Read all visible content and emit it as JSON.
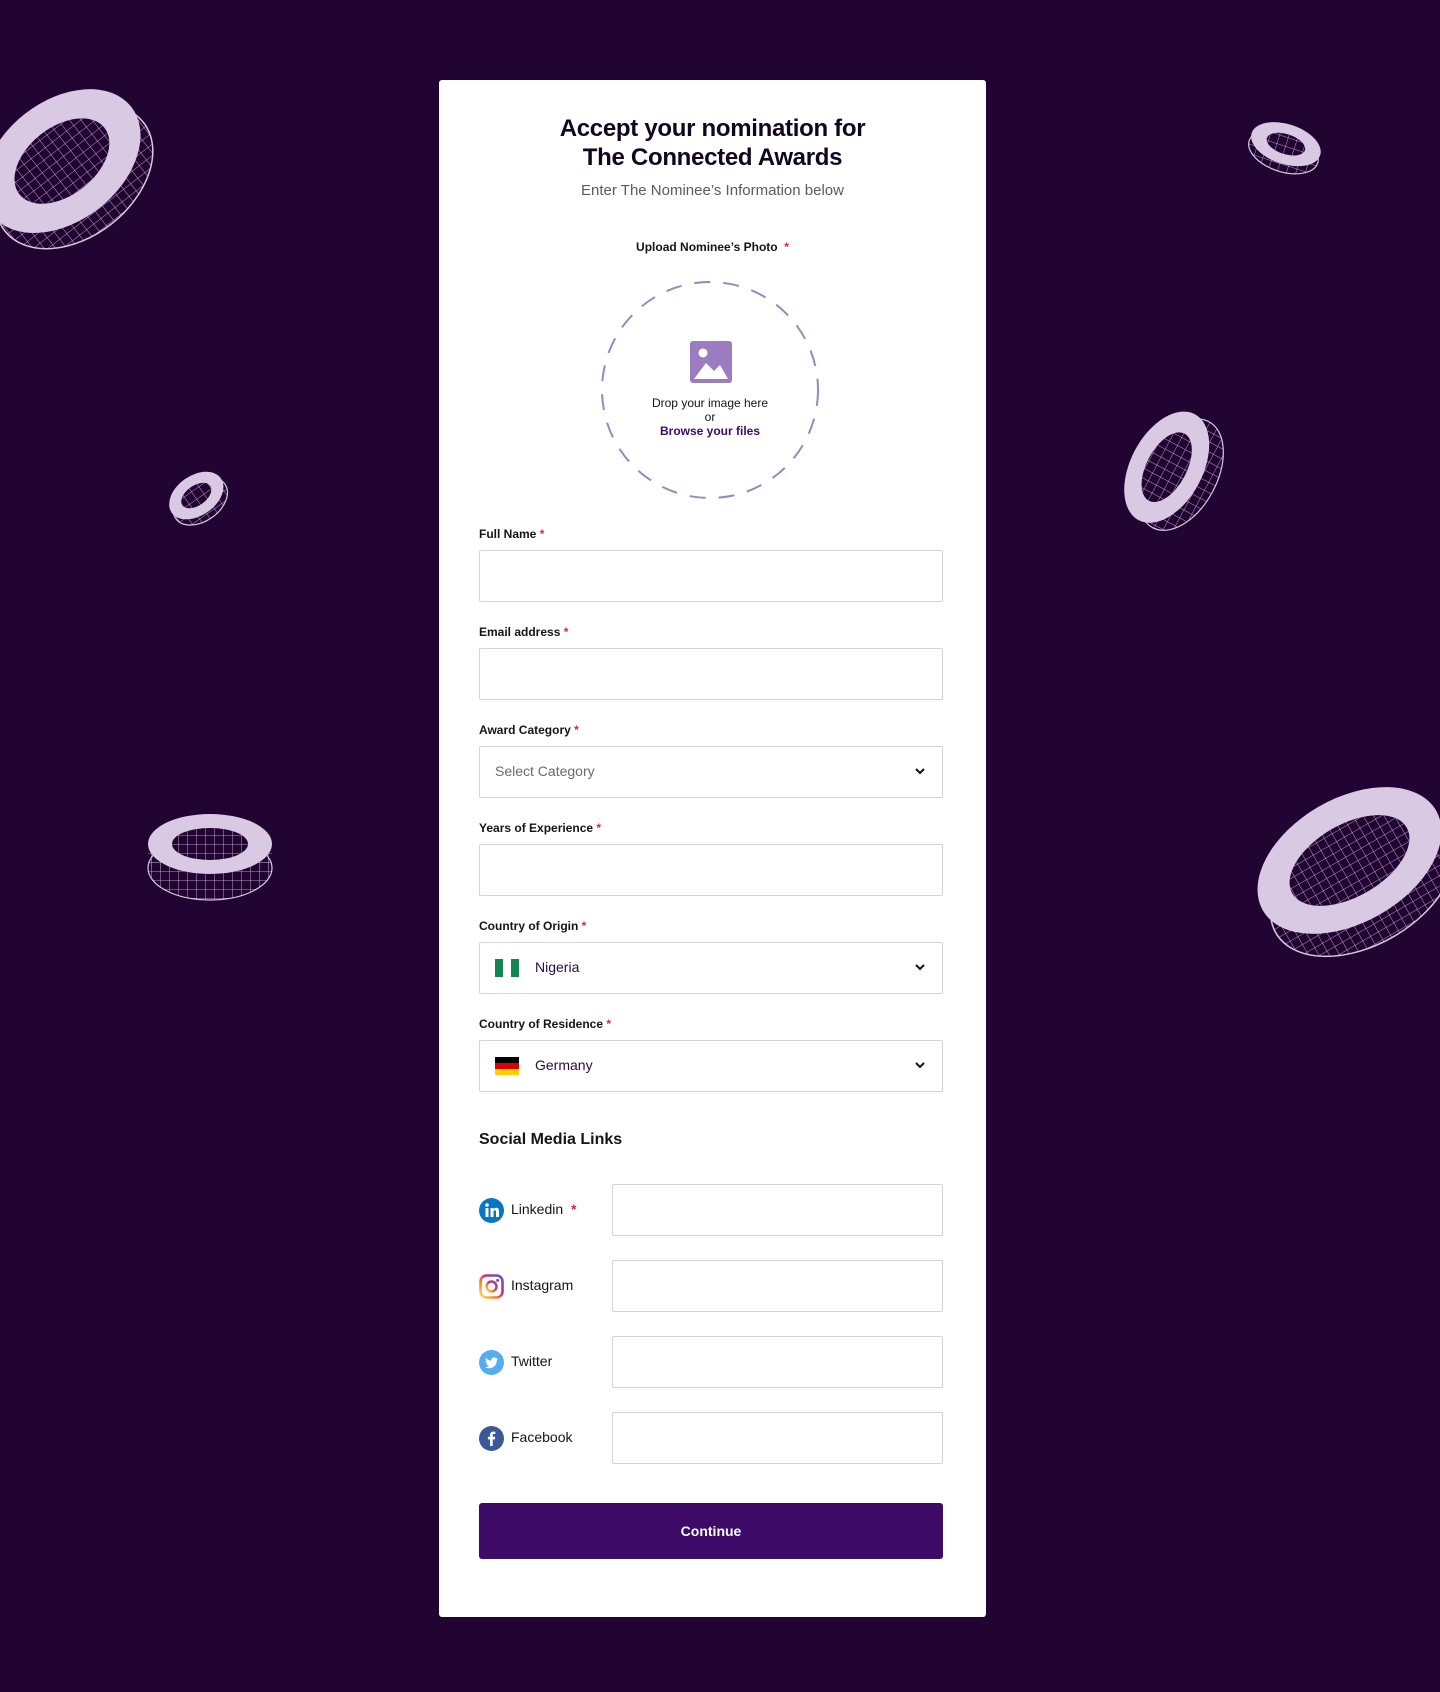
{
  "colors": {
    "background": "#220433",
    "card": "#ffffff",
    "primary": "#3d0a68",
    "required": "#e0243a",
    "ring": "#d9c9e3",
    "dashed_border": "#9b86c0"
  },
  "header": {
    "title_line1": "Accept your nomination for",
    "title_line2": "The Connected Awards",
    "subtitle": "Enter The Nominee’s Information below"
  },
  "upload": {
    "label": "Upload Nominee’s Photo",
    "required_mark": "*",
    "icon": "image-icon",
    "drop_text": "Drop your image here",
    "or_text": "or",
    "browse_text": "Browse your files"
  },
  "fields": {
    "full_name": {
      "label": "Full Name",
      "required_mark": "*",
      "value": ""
    },
    "email": {
      "label": "Email address",
      "required_mark": "*",
      "value": ""
    },
    "award_category": {
      "label": "Award Category",
      "required_mark": "*",
      "placeholder": "Select Category"
    },
    "years_experience": {
      "label": "Years of Experience",
      "required_mark": "*",
      "value": ""
    },
    "country_origin": {
      "label": "Country of Origin",
      "required_mark": "*",
      "value": "Nigeria",
      "flag": "nigeria-flag-icon"
    },
    "country_residence": {
      "label": "Country of Residence",
      "required_mark": "*",
      "value": "Germany",
      "flag": "germany-flag-icon"
    }
  },
  "social": {
    "title": "Social Media Links",
    "items": [
      {
        "label": "Linkedin",
        "required_mark": "*",
        "icon": "linkedin-icon",
        "color": "#0a75c2"
      },
      {
        "label": "Instagram",
        "required_mark": "",
        "icon": "instagram-icon",
        "color": "#d62976"
      },
      {
        "label": "Twitter",
        "required_mark": "",
        "icon": "twitter-icon",
        "color": "#55acee"
      },
      {
        "label": "Facebook",
        "required_mark": "",
        "icon": "facebook-icon",
        "color": "#3b5998"
      }
    ]
  },
  "continue_label": "Continue"
}
